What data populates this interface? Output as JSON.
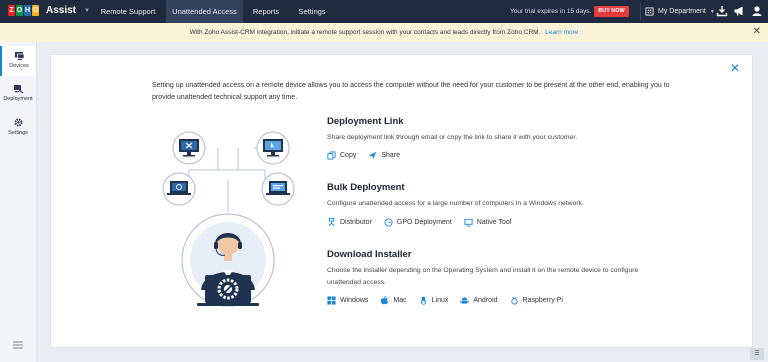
{
  "topbar": {
    "logo_letters": [
      "Z",
      "O",
      "H",
      "O"
    ],
    "app_name": "Assist",
    "tabs": [
      {
        "label": "Remote Support",
        "active": false
      },
      {
        "label": "Unattended Access",
        "active": true
      },
      {
        "label": "Reports",
        "active": false
      },
      {
        "label": "Settings",
        "active": false
      }
    ],
    "trial_text": "Your trial expires in 15 days.",
    "buy_now": "BUY NOW",
    "department": "My Department",
    "icons": [
      "download-icon",
      "megaphone-icon",
      "user-icon"
    ]
  },
  "banner": {
    "text": "With Zoho Assist-CRM integration, initiate a remote support session with your contacts and leads directly from Zoho CRM.",
    "link": "Learn more"
  },
  "sidebar": {
    "items": [
      {
        "label": "Devices",
        "icon": "devices-icon",
        "active": true
      },
      {
        "label": "Deployment",
        "icon": "deployment-icon",
        "active": false
      },
      {
        "label": "Settings",
        "icon": "gear-icon",
        "active": false
      }
    ]
  },
  "main": {
    "intro": "Setting up unattended access on a remote device allows you to access the computer without the need for your customer to be present at the other end, enabling you to provide unattended technical support any time.",
    "sections": [
      {
        "title": "Deployment Link",
        "description": "Share deployment link through email or copy the link to share it with your customer.",
        "actions": [
          {
            "label": "Copy",
            "icon": "copy-icon"
          },
          {
            "label": "Share",
            "icon": "send-icon"
          }
        ]
      },
      {
        "title": "Bulk Deployment",
        "description": "Configure unattended access for a large number of computers in a Windows network.",
        "actions": [
          {
            "label": "Distributor",
            "icon": "distributor-icon"
          },
          {
            "label": "GPO Deployment",
            "icon": "gpo-icon"
          },
          {
            "label": "Native Tool",
            "icon": "native-tool-icon"
          }
        ]
      },
      {
        "title": "Download Installer",
        "description": "Choose the installer depending on the Operating System and install it on the remote device to configure unattended access.",
        "actions": [
          {
            "label": "Windows",
            "icon": "windows-icon"
          },
          {
            "label": "Mac",
            "icon": "apple-icon"
          },
          {
            "label": "Linux",
            "icon": "linux-icon"
          },
          {
            "label": "Android",
            "icon": "android-icon"
          },
          {
            "label": "Raspberry Pi",
            "icon": "raspberry-pi-icon"
          }
        ]
      }
    ]
  },
  "colors": {
    "topbar_bg": "#1f2a3e",
    "active_tab_bg": "#33415b",
    "accent": "#1a87d6",
    "buy_now": "#e23d3d",
    "banner_bg": "#fbf3d7"
  }
}
